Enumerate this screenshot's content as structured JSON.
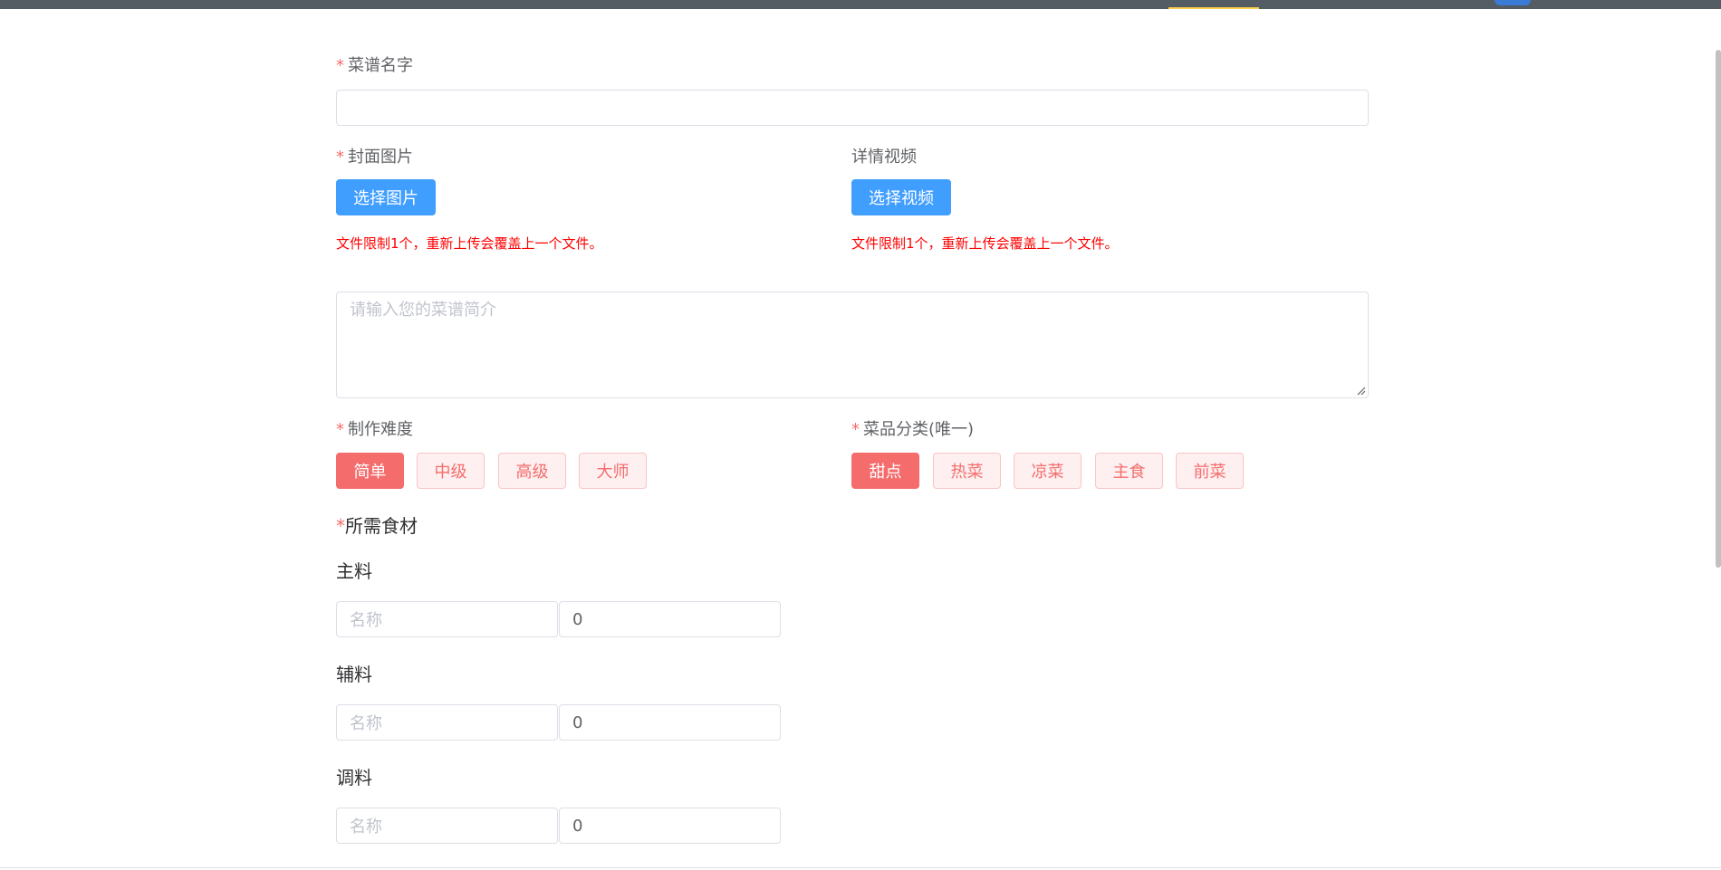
{
  "form": {
    "recipe_name": {
      "label": "菜谱名字",
      "required": "*",
      "value": ""
    },
    "cover": {
      "label": "封面图片",
      "required": "*",
      "button": "选择图片",
      "hint": "文件限制1个，重新上传会覆盖上一个文件。"
    },
    "video": {
      "label": "详情视频",
      "button": "选择视频",
      "hint": "文件限制1个，重新上传会覆盖上一个文件。"
    },
    "intro": {
      "placeholder": "请输入您的菜谱简介"
    },
    "difficulty": {
      "label": "制作难度",
      "required": "*",
      "options": [
        "简单",
        "中级",
        "高级",
        "大师"
      ],
      "selected": "简单"
    },
    "category": {
      "label": "菜品分类(唯一)",
      "required": "*",
      "options": [
        "甜点",
        "热菜",
        "凉菜",
        "主食",
        "前菜"
      ],
      "selected": "甜点"
    },
    "ingredients": {
      "title": "所需食材",
      "required": "*",
      "groups": [
        {
          "title": "主料",
          "name_placeholder": "名称",
          "amount": "0"
        },
        {
          "title": "辅料",
          "name_placeholder": "名称",
          "amount": "0"
        },
        {
          "title": "调料",
          "name_placeholder": "名称",
          "amount": "0"
        }
      ]
    }
  },
  "colors": {
    "primary": "#409eff",
    "danger": "#f56c6c",
    "danger_light": "#fef0f0",
    "hint": "#ff0000",
    "nav": "#545c64"
  }
}
